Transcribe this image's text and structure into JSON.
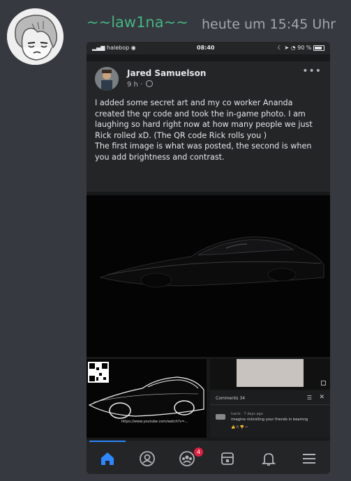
{
  "message": {
    "username": "~~law1na~~",
    "timestamp": "heute um 15:45 Uhr",
    "username_color": "#43b581"
  },
  "phone_status": {
    "carrier": "halebop",
    "time": "08:40",
    "battery": "90 %"
  },
  "post": {
    "author": "Jared Samuelson",
    "age": "9 h",
    "text_1": "I added some secret art and my co worker Ananda created the qr code and took the in-game photo. I am laughing so hard right now at how many people we just Rick rolled xD. (The QR code Rick rolls you )",
    "text_2": "The first image is what was posted, the second is when you add brightness and contrast."
  },
  "comments_panel": {
    "title": "Comments",
    "count": "34",
    "commenter": "Ivaris · 7 days ago",
    "comment": "imagine rickrolling your friends in beamng",
    "actions": "👍 6  👎  ↩"
  },
  "qr_caption": "https://www.youtube.com/watch?v=...",
  "tabbar": {
    "notification_badge": "4",
    "active_color": "#2d88ff"
  }
}
